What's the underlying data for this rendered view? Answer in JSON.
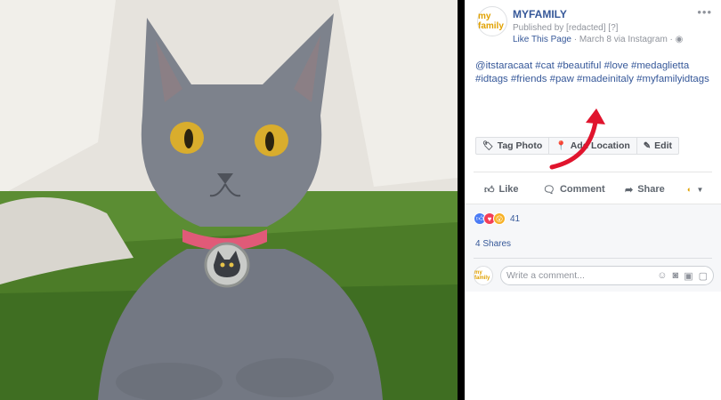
{
  "page": {
    "name": "MYFAMILY",
    "avatar_text": "my family",
    "published": "Published by [redacted] [?]",
    "like_page": "Like This Page",
    "meta_sep": " · March 8 via Instagram · ",
    "more": "•••"
  },
  "caption": {
    "mention": "@itstaracaat",
    "tags": [
      "#cat",
      "#beautiful",
      "#love",
      "#medaglietta",
      "#idtags",
      "#friends",
      "#paw",
      "#madeinitaly",
      "#myfamilyidtags"
    ]
  },
  "actions": {
    "tag_photo": "Tag Photo",
    "add_location": "Add Location",
    "edit": "Edit"
  },
  "engage": {
    "like": "Like",
    "comment": "Comment",
    "share": "Share"
  },
  "reactions": {
    "count": "41"
  },
  "shares": "4 Shares",
  "comment": {
    "placeholder": "Write a comment..."
  },
  "colors": {
    "link": "#365899",
    "arrow": "#e0142d",
    "grass": "#4a7a2a",
    "cat": "#7b8089",
    "eye": "#d4a829",
    "collar": "#e05a78"
  }
}
